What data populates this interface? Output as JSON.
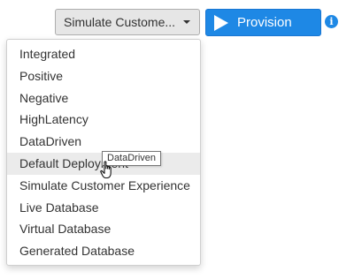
{
  "toolbar": {
    "scenario_dropdown": {
      "selected": "Simulate Custome...",
      "icon": "chevron-down-icon"
    },
    "provision_button": {
      "label": "Provision",
      "icon": "play-icon",
      "color": "#1e88e5"
    },
    "info_icon": {
      "glyph": "i",
      "icon": "info-icon"
    }
  },
  "menu": {
    "items": [
      {
        "label": "Integrated"
      },
      {
        "label": "Positive"
      },
      {
        "label": "Negative"
      },
      {
        "label": "HighLatency"
      },
      {
        "label": "DataDriven"
      },
      {
        "label": "Default Deployment"
      },
      {
        "label": "Simulate Customer Experience"
      },
      {
        "label": "Live Database"
      },
      {
        "label": "Virtual Database"
      },
      {
        "label": "Generated Database"
      }
    ],
    "hovered_item": "Default Deployment"
  },
  "tooltip": {
    "text": "DataDriven"
  },
  "cursor": {
    "icon": "hand-pointer-icon"
  }
}
